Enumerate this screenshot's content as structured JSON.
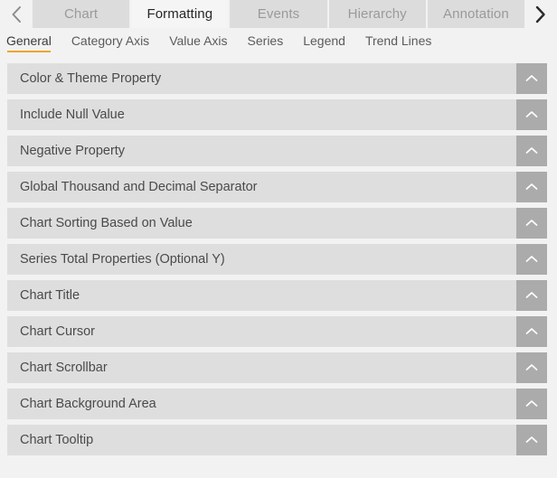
{
  "tabbar": {
    "prev_icon": "chevron-left-icon",
    "next_icon": "chevron-right-icon",
    "tabs": [
      {
        "label": "Chart",
        "active": false
      },
      {
        "label": "Formatting",
        "active": true
      },
      {
        "label": "Events",
        "active": false
      },
      {
        "label": "Hierarchy",
        "active": false
      },
      {
        "label": "Annotation",
        "active": false
      }
    ]
  },
  "subtabs": {
    "items": [
      {
        "label": "General",
        "active": true
      },
      {
        "label": "Category Axis",
        "active": false
      },
      {
        "label": "Value Axis",
        "active": false
      },
      {
        "label": "Series",
        "active": false
      },
      {
        "label": "Legend",
        "active": false
      },
      {
        "label": "Trend Lines",
        "active": false
      }
    ],
    "active_underline_color": "#eda52f"
  },
  "sections": {
    "toggle_icon": "chevron-up-icon",
    "items": [
      {
        "label": "Color & Theme Property"
      },
      {
        "label": "Include Null Value"
      },
      {
        "label": "Negative Property"
      },
      {
        "label": "Global Thousand and Decimal Separator"
      },
      {
        "label": "Chart Sorting Based on Value"
      },
      {
        "label": "Series Total Properties (Optional Y)"
      },
      {
        "label": "Chart Title"
      },
      {
        "label": "Chart Cursor"
      },
      {
        "label": "Chart Scrollbar"
      },
      {
        "label": "Chart Background Area"
      },
      {
        "label": "Chart Tooltip"
      }
    ]
  },
  "colors": {
    "page_background": "#f2f2f2",
    "row_background": "#dedede",
    "toggle_background": "#ababab",
    "tab_inactive_background": "#dcdcdc",
    "tab_active_background": "#f5f5f5",
    "accent": "#eda52f"
  }
}
